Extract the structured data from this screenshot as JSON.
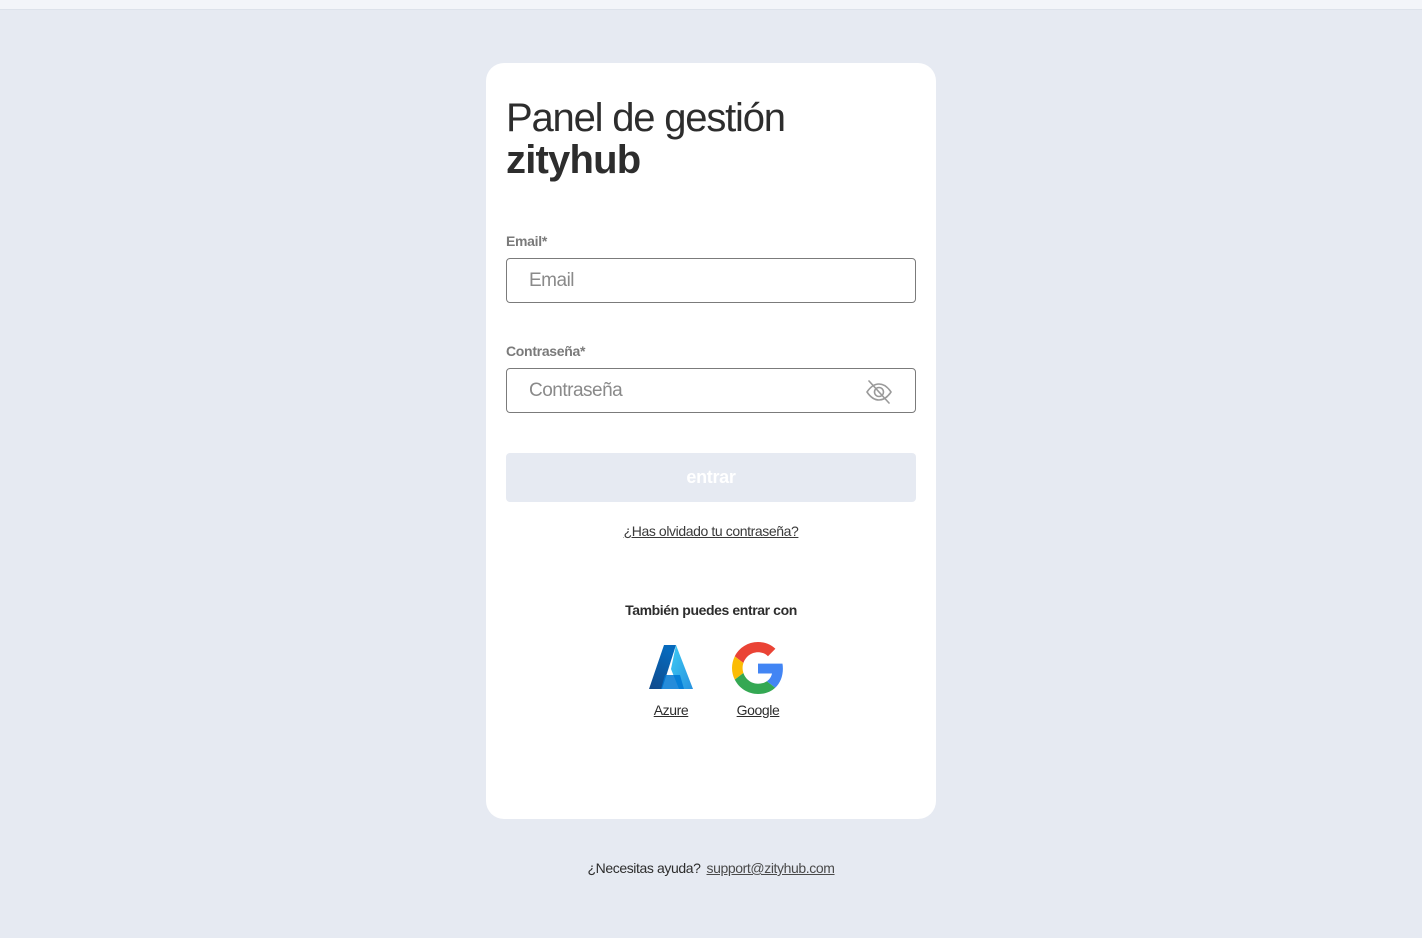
{
  "header": {
    "title_line1": "Panel de gestión",
    "title_line2": "zityhub"
  },
  "form": {
    "email": {
      "label": "Email*",
      "placeholder": "Email",
      "value": ""
    },
    "password": {
      "label": "Contraseña*",
      "placeholder": "Contraseña",
      "value": "",
      "toggle_icon": "eye-off-icon"
    },
    "submit_label": "entrar",
    "submit_enabled": false,
    "forgot_password_label": "¿Has olvidado tu contraseña?"
  },
  "sso": {
    "heading": "También puedes entrar con",
    "providers": [
      {
        "label": "Azure",
        "icon": "azure-logo-icon"
      },
      {
        "label": "Google",
        "icon": "google-logo-icon"
      }
    ]
  },
  "footer": {
    "help_text": "¿Necesitas ayuda?",
    "support_email": "support@zityhub.com"
  },
  "colors": {
    "page_background": "#e6eaf2",
    "card_background": "#ffffff",
    "text": "#2d2d2d",
    "disabled_button": "#e6eaf2"
  }
}
